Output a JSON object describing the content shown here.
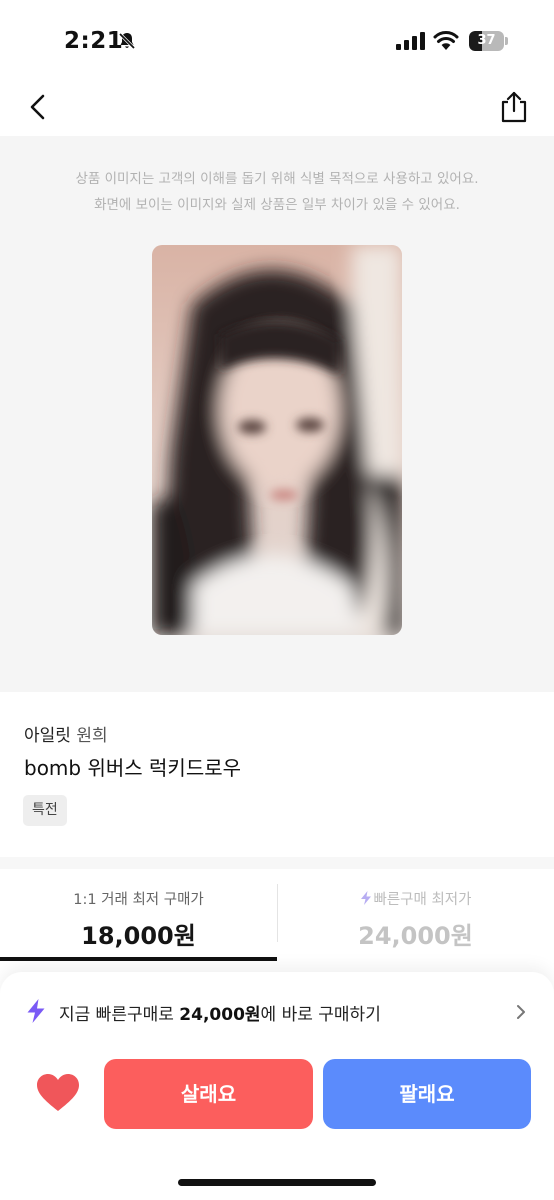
{
  "status_bar": {
    "time": "2:21",
    "battery_level": "37",
    "battery_fraction": 0.37
  },
  "nav": {
    "back_icon": "chevron-left-icon",
    "share_icon": "share-icon"
  },
  "image_panel": {
    "notice_line1": "상품 이미지는 고객의 이해를 돕기 위해 식별 목적으로 사용하고 있어요.",
    "notice_line2": "화면에 보이는 이미지와 실제 상품은 일부 차이가 있을 수 있어요."
  },
  "product": {
    "brand": "아일릿",
    "member": "원희",
    "name": "bomb 위버스 럭키드로우",
    "tag": "특전"
  },
  "price_tabs": [
    {
      "label": "1:1 거래 최저 구매가",
      "value": "18,000원",
      "selected": true
    },
    {
      "label": "빠른구매 최저가",
      "value": "24,000원",
      "selected": false
    }
  ],
  "quick_buy": {
    "prefix": "지금 빠른구매로 ",
    "price": "24,000원",
    "suffix": "에 바로 구매하기"
  },
  "actions": {
    "buy_label": "살래요",
    "sell_label": "팔래요"
  },
  "colors": {
    "buy": "#fc5e5d",
    "sell": "#5b8bfc",
    "heart": "#f0565a",
    "bolt": "#7a5af5"
  }
}
